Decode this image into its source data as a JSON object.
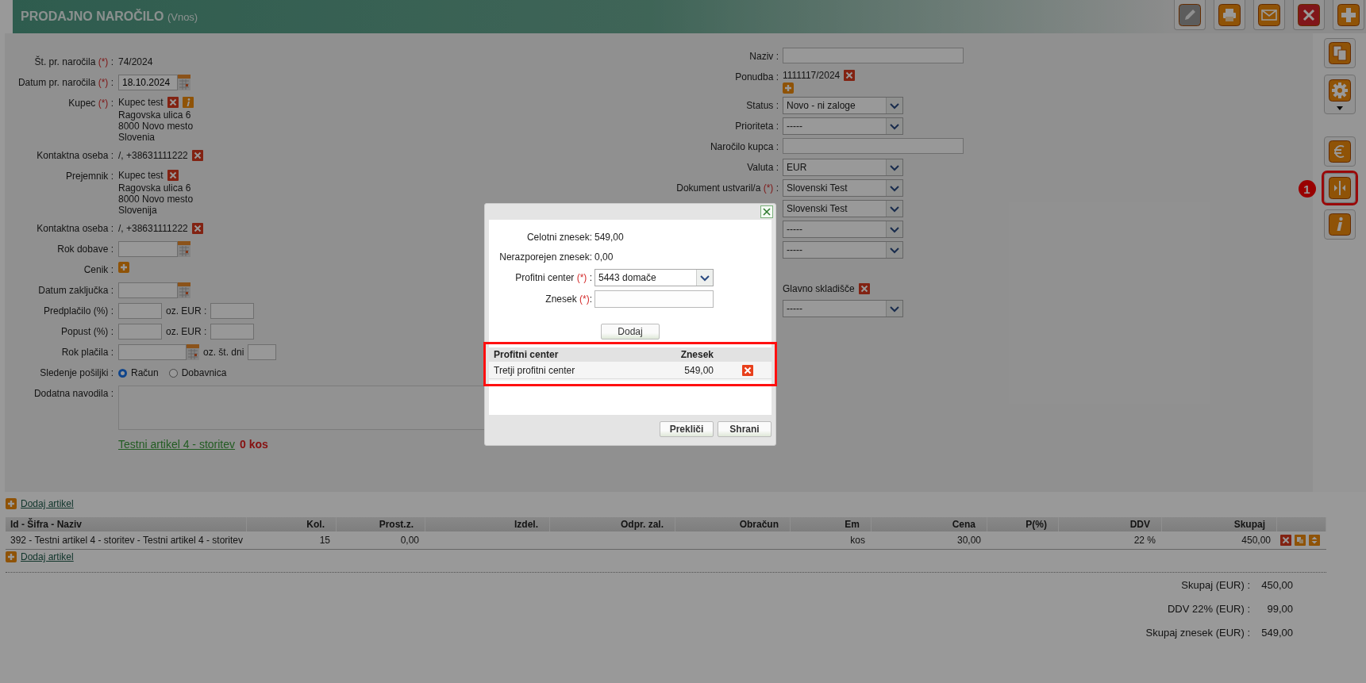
{
  "header": {
    "title": "PRODAJNO NAROČILO",
    "subtitle": "(Vnos)"
  },
  "toolbar": [
    {
      "kind": "pencil",
      "disabled": true
    },
    {
      "kind": "printer",
      "disabled": false
    },
    {
      "kind": "envelope",
      "disabled": false
    },
    {
      "kind": "close",
      "disabled": false
    },
    {
      "kind": "plus",
      "disabled": false
    }
  ],
  "side_toolbar": [
    {
      "kind": "copy",
      "highlighted": false
    },
    {
      "kind": "gear",
      "highlighted": false,
      "has_dropdown": true
    },
    {
      "kind": "euro",
      "highlighted": false
    },
    {
      "kind": "split",
      "highlighted": true,
      "callout": "1"
    },
    {
      "kind": "info",
      "highlighted": false
    }
  ],
  "left_fields": [
    {
      "kind": "text",
      "label": "Št. pr. naročila",
      "required_mark": "(*)",
      "colon": ":",
      "value": "74/2024"
    },
    {
      "kind": "date",
      "label": "Datum pr. naročila",
      "required_mark": "(*)",
      "colon": ":",
      "value": "18.10.2024"
    },
    {
      "kind": "party",
      "label": "Kupec",
      "required_mark": "(*)",
      "colon": ":",
      "lines": [
        "Kupec test",
        "Ragovska ulica 6",
        "8000 Novo mesto",
        "Slovenia"
      ],
      "info": true
    },
    {
      "kind": "contact",
      "label": "Kontaktna oseba",
      "colon": ":",
      "value": "/, +38631111222"
    },
    {
      "kind": "party",
      "label": "Prejemnik",
      "colon": ":",
      "lines": [
        "Kupec test",
        "Ragovska ulica 6",
        "8000 Novo mesto",
        "Slovenija"
      ],
      "info": false
    },
    {
      "kind": "contact",
      "label": "Kontaktna oseba",
      "colon": ":",
      "value": "/, +38631111222"
    },
    {
      "kind": "date",
      "label": "Rok dobave",
      "colon": ":"
    },
    {
      "kind": "add",
      "label": "Cenik",
      "colon": ":"
    },
    {
      "kind": "date",
      "label": "Datum zaključka",
      "colon": ":"
    },
    {
      "kind": "amount",
      "label": "Predplačilo (%)",
      "colon": ":",
      "alt_label": "oz. EUR :"
    },
    {
      "kind": "amount",
      "label": "Popust (%)",
      "colon": ":",
      "alt_label": "oz. EUR :"
    },
    {
      "kind": "due",
      "label": "Rok plačila",
      "colon": ":",
      "alt_label": "oz. št. dni"
    },
    {
      "kind": "radio",
      "label": "Sledenje pošiljki",
      "colon": ":",
      "options": [
        {
          "label": "Račun",
          "selected": true
        },
        {
          "label": "Dobavnica",
          "selected": false
        }
      ]
    },
    {
      "kind": "textarea",
      "label": "Dodatna navodila",
      "colon": ":"
    }
  ],
  "stock_note": {
    "link": "Testni artikel 4 - storitev",
    "quantity": "0 kos"
  },
  "right_fields": [
    {
      "kind": "input",
      "label": "Naziv",
      "colon": ":"
    },
    {
      "kind": "offer",
      "label": "Ponudba",
      "colon": ":",
      "value": "1111117/2024"
    },
    {
      "kind": "select",
      "label": "Status",
      "colon": ":",
      "value": "Novo - ni zaloge"
    },
    {
      "kind": "select",
      "label": "Prioriteta",
      "colon": ":",
      "value": "-----"
    },
    {
      "kind": "input",
      "label": "Naročilo kupca",
      "colon": ":"
    },
    {
      "kind": "select",
      "label": "Valuta",
      "colon": ":",
      "value": "EUR"
    },
    {
      "kind": "select",
      "label": "Dokument ustvaril/a",
      "required_mark": "(*)",
      "colon": ":",
      "value": "Slovenski Test"
    },
    {
      "kind": "select",
      "value": "Slovenski Test"
    },
    {
      "kind": "select",
      "value": "-----"
    },
    {
      "kind": "select",
      "value": "-----"
    },
    {
      "kind": "warehouse",
      "value": "Glavno skladišče"
    },
    {
      "kind": "select",
      "value": "-----"
    }
  ],
  "add_article_links": [
    "Dodaj artikel",
    "Dodaj artikel"
  ],
  "items_table": {
    "columns": [
      "Id - Šifra - Naziv",
      "Kol.",
      "Prost.z.",
      "Izdel.",
      "Odpr. zal.",
      "Obračun",
      "Em",
      "Cena",
      "P(%)",
      "DDV",
      "Skupaj"
    ],
    "rows": [
      {
        "cells": [
          "392 - Testni artikel 4 - storitev - Testni artikel 4 - storitev",
          "15",
          "0,00",
          null,
          null,
          null,
          "kos",
          "30,00",
          null,
          "22 %",
          "450,00"
        ]
      }
    ]
  },
  "totals": [
    {
      "label": "Skupaj (EUR) :",
      "value": "450,00"
    },
    {
      "label": "DDV 22% (EUR) :",
      "value": "99,00"
    },
    {
      "label": "Skupaj znesek (EUR) :",
      "value": "549,00"
    }
  ],
  "dialog": {
    "summary": [
      {
        "label": "Celotni znesek:",
        "value": "549,00"
      },
      {
        "label": "Nerazporejen znesek:",
        "value": "0,00"
      }
    ],
    "profit_center": {
      "label": "Profitni center",
      "required_mark": "(*)",
      "colon": ":",
      "value": "5443 domače"
    },
    "amount": {
      "label": "Znesek",
      "required_mark": "(*)",
      "colon": ":"
    },
    "add_button": "Dodaj",
    "table": {
      "highlighted": true,
      "columns": [
        "Profitni center",
        "Znesek"
      ],
      "rows": [
        {
          "center": "Tretji profitni center",
          "amount": "549,00"
        }
      ]
    },
    "buttons": [
      "Prekliči",
      "Shrani"
    ]
  }
}
